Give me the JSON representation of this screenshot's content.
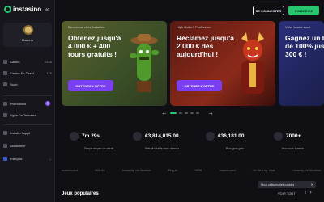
{
  "brand": {
    "name": "instasino"
  },
  "user": {
    "name": "Masters"
  },
  "sidebar": {
    "items": [
      {
        "label": "Casino",
        "count": "0456"
      },
      {
        "label": "Casino En Direct",
        "count": "126"
      },
      {
        "label": "Sport",
        "count": ""
      }
    ],
    "items2": [
      {
        "label": "Promotions",
        "badge": "9"
      },
      {
        "label": "Ligue Du Tonnerre"
      }
    ],
    "items3": [
      {
        "label": "Installer l'appli"
      },
      {
        "label": "Assistance"
      },
      {
        "label": "Français"
      }
    ]
  },
  "header": {
    "connect_label": "SE CONNECTER",
    "signup_label": "S'INSCRIRE"
  },
  "banners": [
    {
      "subtitle": "Bienvenue chez Instasino",
      "title": "Obtenez jusqu'à 4 000 € + 400 tours gratuits !",
      "button": "OBTENEZ L'OFFRE"
    },
    {
      "subtitle": "High Roller? Profitez-en",
      "title": "Réclamez jusqu'à 2 000 € dès aujourd'hui !",
      "button": "OBTENEZ L'OFFRE"
    },
    {
      "subtitle": "Votre bonus sport",
      "title": "Gagnez un b de 100% jus 300 € !",
      "button": ""
    }
  ],
  "stats": [
    {
      "value": "7m 29s",
      "label": "Temps moyen de retrait"
    },
    {
      "value": "€3,814,015.00",
      "label": "Retrait total le mois dernier"
    },
    {
      "value": "€36,181.00",
      "label": "Plus gros gain"
    },
    {
      "value": "7000+",
      "label": "Jeux sous licence"
    }
  ],
  "payments": [
    "mastercard",
    "Mifinity",
    "Instantly Verification",
    "Crypto",
    "VISA",
    "mastercard",
    "Verified by Visa",
    "Instantly Verification"
  ],
  "section": {
    "title": "Jeux populaires",
    "see_all": "VOIR TOUT"
  },
  "cookie": {
    "text": "Nous utilisons des cookies"
  },
  "colors": {
    "accent_green": "#28c76f",
    "accent_purple": "#7b3ff2",
    "background": "#0f0f14"
  }
}
